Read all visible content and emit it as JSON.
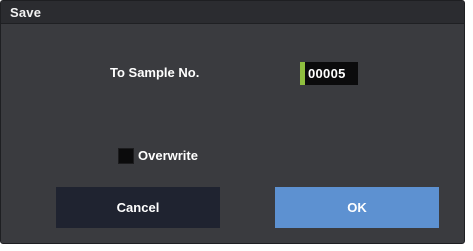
{
  "dialog": {
    "title": "Save",
    "sample_label": "To Sample No.",
    "sample_value": "00005",
    "overwrite": {
      "label": "Overwrite",
      "checked": false
    },
    "buttons": {
      "cancel_label": "Cancel",
      "ok_label": "OK"
    }
  },
  "colors": {
    "dialog_background": "#3a3b3f",
    "title_bar": "#2b2c30",
    "field_marker": "#8fbf3f",
    "cancel_button": "#1f2330",
    "ok_button": "#5d91d1"
  }
}
